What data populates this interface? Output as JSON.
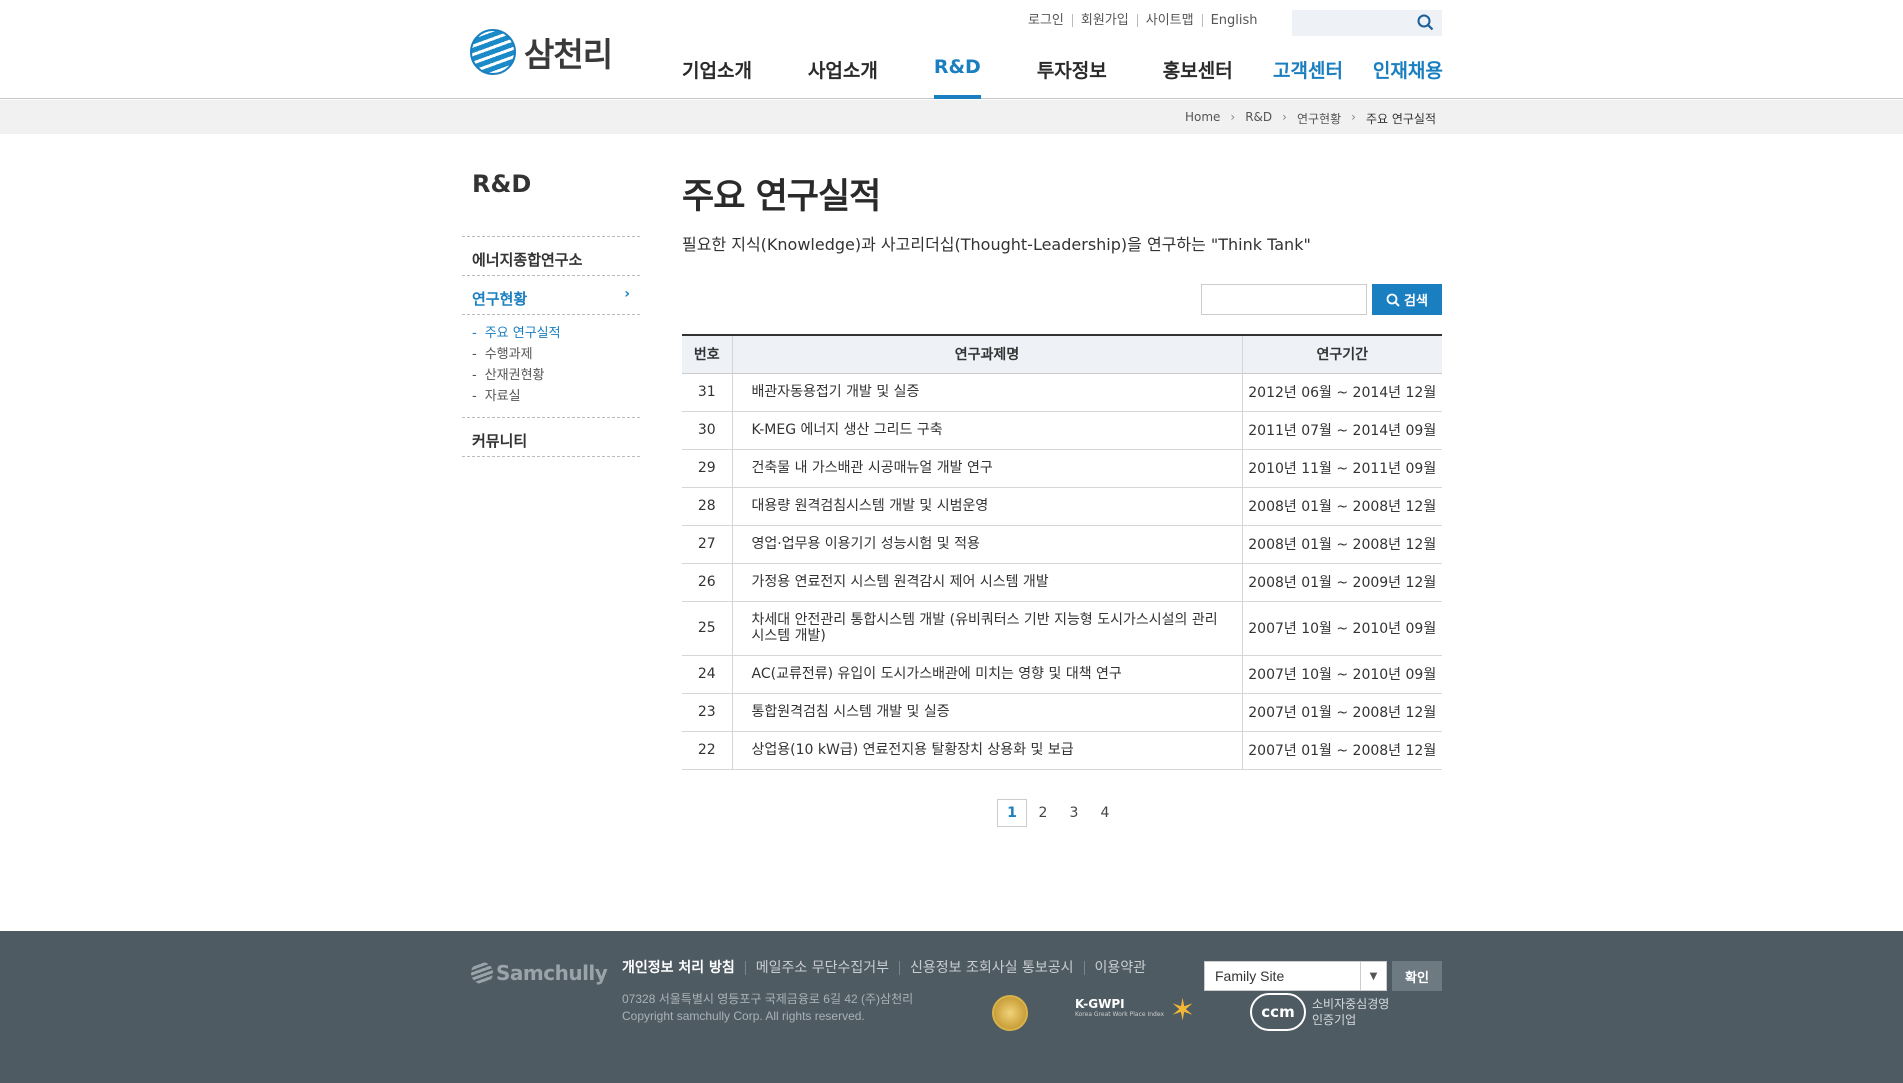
{
  "header": {
    "logo_text": "삼천리",
    "util_links": [
      "로그인",
      "회원가입",
      "사이트맵",
      "English"
    ],
    "search_placeholder": "",
    "gnb": [
      "기업소개",
      "사업소개",
      "R&D",
      "투자정보",
      "홍보센터"
    ],
    "gnb_active": "R&D",
    "gnb_right": [
      "고객센터",
      "인재채용"
    ]
  },
  "breadcrumb": [
    "Home",
    "R&D",
    "연구현황",
    "주요 연구실적"
  ],
  "sidebar": {
    "title": "R&D",
    "items": [
      {
        "label": "에너지종합연구소",
        "active": false
      },
      {
        "label": "연구현황",
        "active": true
      }
    ],
    "sub_items": [
      {
        "label": "주요 연구실적",
        "active": true
      },
      {
        "label": "수행과제",
        "active": false
      },
      {
        "label": "산재권현황",
        "active": false
      },
      {
        "label": "자료실",
        "active": false
      }
    ],
    "last_item": "커뮤니티"
  },
  "main": {
    "title": "주요 연구실적",
    "description": "필요한 지식(Knowledge)과 사고리더십(Thought-Leadership)을 연구하는 \"Think Tank\"",
    "search_value": "",
    "search_button": "검색",
    "table": {
      "headers": [
        "번호",
        "연구과제명",
        "연구기간"
      ],
      "rows": [
        {
          "no": "31",
          "title": "배관자동용접기 개발 및 실증",
          "period": "2012년 06월 ~ 2014년 12월"
        },
        {
          "no": "30",
          "title": "K-MEG 에너지 생산 그리드 구축",
          "period": "2011년 07월 ~ 2014년 09월"
        },
        {
          "no": "29",
          "title": "건축물 내 가스배관 시공매뉴얼 개발 연구",
          "period": "2010년 11월 ~ 2011년 09월"
        },
        {
          "no": "28",
          "title": "대용량 원격검침시스템 개발 및 시범운영",
          "period": "2008년 01월 ~ 2008년 12월"
        },
        {
          "no": "27",
          "title": "영업·업무용 이용기기 성능시험 및 적용",
          "period": "2008년 01월 ~ 2008년 12월"
        },
        {
          "no": "26",
          "title": "가정용 연료전지 시스템 원격감시 제어 시스템 개발",
          "period": "2008년 01월 ~ 2009년 12월"
        },
        {
          "no": "25",
          "title": "차세대 안전관리 통합시스템 개발 (유비쿼터스 기반 지능형 도시가스시설의 관리시스템 개발)",
          "period": "2007년 10월 ~ 2010년 09월"
        },
        {
          "no": "24",
          "title": "AC(교류전류) 유입이 도시가스배관에 미치는 영향 및 대책 연구",
          "period": "2007년 10월 ~ 2010년 09월"
        },
        {
          "no": "23",
          "title": "통합원격검침 시스템 개발 및 실증",
          "period": "2007년 01월 ~ 2008년 12월"
        },
        {
          "no": "22",
          "title": "상업용(10 kW급) 연료전지용 탈황장치 상용화 및 보급",
          "period": "2007년 01월 ~ 2008년 12월"
        }
      ]
    },
    "pagination": {
      "pages": [
        "1",
        "2",
        "3",
        "4"
      ],
      "current": "1"
    }
  },
  "footer": {
    "logo_text": "Samchully",
    "links": [
      "개인정보 처리 방침",
      "메일주소 무단수집거부",
      "신용정보 조회사실 통보공시",
      "이용약관"
    ],
    "address": "07328 서울특별시 영등포구 국제금융로 6길 42 (주)삼천리",
    "copyright": "Copyright samchully Corp. All rights reserved.",
    "cert_kgwpi_title": "K-GWPI",
    "cert_kgwpi_sub": "Korea Great Work Place Index",
    "cert_ccm_logo": "ccm",
    "cert_ccm_text1": "소비자중심경영",
    "cert_ccm_text2": "인증기업",
    "family_site": "Family Site",
    "confirm_button": "확인"
  },
  "colors": {
    "accent": "#1a7fc0",
    "footer_bg": "#4f5b63",
    "crumb_bg": "#f1f1f1"
  }
}
